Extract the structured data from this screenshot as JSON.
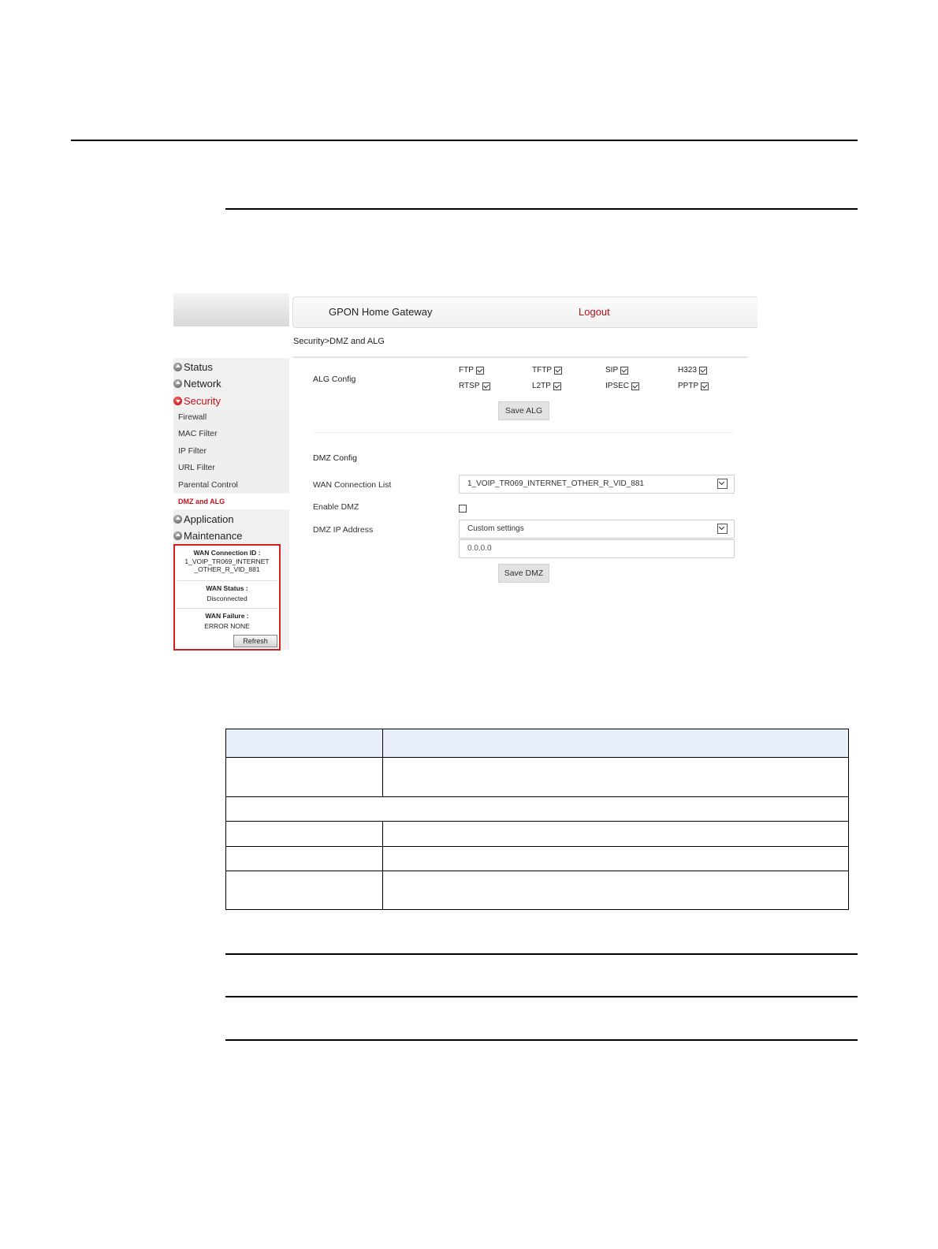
{
  "window": {
    "app_title": "GPON Home Gateway",
    "logout_label": "Logout",
    "breadcrumb": "Security>DMZ and ALG"
  },
  "sidebar": {
    "menu": [
      {
        "label": "Status",
        "active": false
      },
      {
        "label": "Network",
        "active": false
      },
      {
        "label": "Security",
        "active": true
      },
      {
        "label": "Application",
        "active": false
      },
      {
        "label": "Maintenance",
        "active": false
      }
    ],
    "security_submenu": [
      "Firewall",
      "MAC Filter",
      "IP Filter",
      "URL Filter",
      "Parental Control",
      "DMZ and ALG"
    ],
    "active_submenu": "DMZ and ALG",
    "wan_status": {
      "connection_id_label": "WAN Connection ID :",
      "connection_id_line1": "1_VOIP_TR069_INTERNET",
      "connection_id_line2": "_OTHER_R_VID_881",
      "status_label": "WAN Status :",
      "status_value": "Disconnected",
      "failure_label": "WAN Failure :",
      "failure_value": "ERROR NONE",
      "refresh_label": "Refresh"
    }
  },
  "alg": {
    "section_label": "ALG Config",
    "options": [
      {
        "label": "FTP",
        "checked": true
      },
      {
        "label": "TFTP",
        "checked": true
      },
      {
        "label": "SIP",
        "checked": true
      },
      {
        "label": "H323",
        "checked": true
      },
      {
        "label": "RTSP",
        "checked": true
      },
      {
        "label": "L2TP",
        "checked": true
      },
      {
        "label": "IPSEC",
        "checked": true
      },
      {
        "label": "PPTP",
        "checked": true
      }
    ],
    "save_label": "Save ALG"
  },
  "dmz": {
    "section_label": "DMZ Config",
    "wan_list_label": "WAN Connection List",
    "wan_list_value": "1_VOIP_TR069_INTERNET_OTHER_R_VID_881",
    "enable_label": "Enable DMZ",
    "enable_checked": false,
    "ip_label": "DMZ IP Address",
    "ip_mode_value": "Custom settings",
    "ip_value": "0.0.0.0",
    "save_label": "Save DMZ"
  },
  "colors": {
    "accent_red": "#c0121c",
    "table_header": "#e8eefc"
  }
}
